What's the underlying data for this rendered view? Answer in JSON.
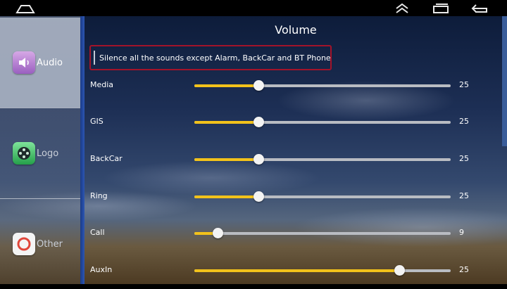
{
  "title": "Volume",
  "silence_option": {
    "label": "Silence all the sounds except Alarm, BackCar and BT Phone",
    "checked": false
  },
  "sidebar": {
    "items": [
      {
        "label": "Audio",
        "icon": "speaker-icon",
        "active": true
      },
      {
        "label": "Logo",
        "icon": "film-reel-icon",
        "active": false
      },
      {
        "label": "Other",
        "icon": "ring-icon",
        "active": false
      }
    ]
  },
  "volume_rows": [
    {
      "label": "Media",
      "value": "25",
      "level": 0.25
    },
    {
      "label": "GIS",
      "value": "25",
      "level": 0.25
    },
    {
      "label": "BackCar",
      "value": "25",
      "level": 0.25
    },
    {
      "label": "Ring",
      "value": "25",
      "level": 0.25
    },
    {
      "label": "Call",
      "value": "9",
      "level": 0.09
    },
    {
      "label": "AuxIn",
      "value": "25",
      "level": 0.8
    }
  ],
  "colors": {
    "slider_fill": "#f2c21b",
    "highlight_border": "#a3132a",
    "divider": "#2c56b4"
  }
}
